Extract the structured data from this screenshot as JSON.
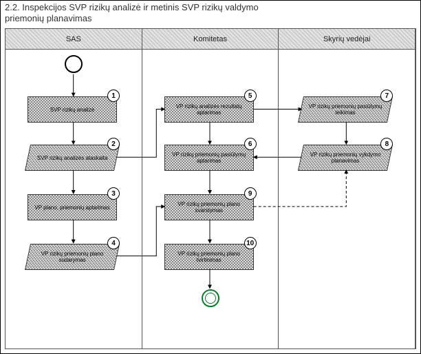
{
  "title": "2.2. Inspekcijos SVP rizikų analizė ir metinis SVP rizikų valdymo priemonių planavimas",
  "lanes": [
    {
      "header": "SAS"
    },
    {
      "header": "Komitetas"
    },
    {
      "header": "Skyrių vedėjai"
    }
  ],
  "nodes": {
    "n1": {
      "num": "1",
      "label": "SVP rizikų analizė"
    },
    "n2": {
      "num": "2",
      "label": "SVP rizikų analizės ataskaita"
    },
    "n3": {
      "num": "3",
      "label": "VP plano, priemonių aptarimas"
    },
    "n4": {
      "num": "4",
      "label": "VP rizikų priemonių plano sudarymas"
    },
    "n5": {
      "num": "5",
      "label": "VP rizikų analizės rezultatų aptarimas"
    },
    "n6": {
      "num": "6",
      "label": "VP rizikų priemonių pasiūlymų aptarimas"
    },
    "n7": {
      "num": "7",
      "label": "VP rizikų priemonių pasiūlymų teikimas"
    },
    "n8": {
      "num": "8",
      "label": "VP rizikų priemonių vykdymo planavimas"
    },
    "n9": {
      "num": "9",
      "label": "VP rizikų priemonių plano svarstymas"
    },
    "n10": {
      "num": "10",
      "label": "VP rizikų priemonių plano tvirtinimas"
    }
  }
}
